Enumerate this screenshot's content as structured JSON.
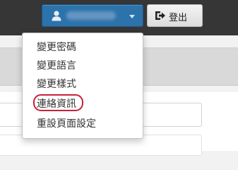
{
  "header": {
    "user_menu": {
      "icon": "user-icon",
      "caret_icon": "caret-down-icon",
      "username_blurred": true
    },
    "logout": {
      "icon": "sign-out-icon",
      "label": "登出"
    }
  },
  "user_dropdown": {
    "items": [
      {
        "label": "變更密碼"
      },
      {
        "label": "變更語言"
      },
      {
        "label": "變更樣式"
      },
      {
        "label": "連絡資訊",
        "highlighted": true
      },
      {
        "label": "重設頁面設定"
      }
    ]
  },
  "colors": {
    "topbar": "#363636",
    "user_button": "#2c73ab",
    "highlight_ring": "#c6213b"
  }
}
